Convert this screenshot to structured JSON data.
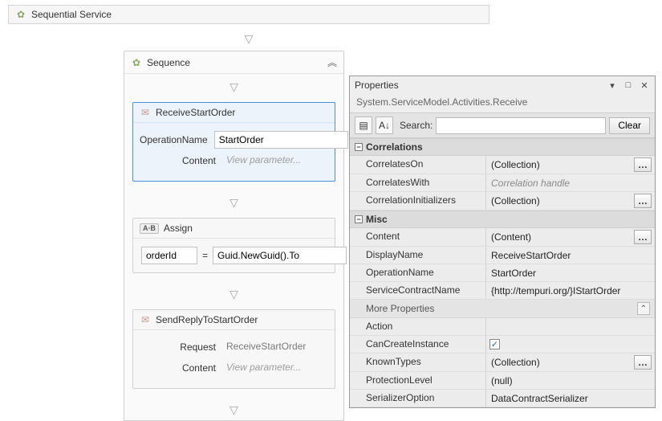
{
  "designer": {
    "root_title": "Sequential Service",
    "sequence": {
      "title": "Sequence",
      "receive": {
        "display_name": "ReceiveStartOrder",
        "op_label": "OperationName",
        "op_value": "StartOrder",
        "content_label": "Content",
        "content_value": "View parameter..."
      },
      "assign": {
        "title": "Assign",
        "left": "orderId",
        "eq": "=",
        "right": "Guid.NewGuid().To"
      },
      "sendreply": {
        "display_name": "SendReplyToStartOrder",
        "req_label": "Request",
        "req_value": "ReceiveStartOrder",
        "content_label": "Content",
        "content_value": "View parameter..."
      }
    }
  },
  "properties": {
    "title": "Properties",
    "subtitle": "System.ServiceModel.Activities.Receive",
    "search_label": "Search:",
    "clear_label": "Clear",
    "groups": {
      "correlations": {
        "label": "Correlations",
        "CorrelatesOn": {
          "label": "CorrelatesOn",
          "value": "(Collection)",
          "ellipsis": true
        },
        "CorrelatesWith": {
          "label": "CorrelatesWith",
          "value": "Correlation handle",
          "italic": true
        },
        "CorrelationInitializers": {
          "label": "CorrelationInitializers",
          "value": "(Collection)",
          "ellipsis": true
        }
      },
      "misc": {
        "label": "Misc",
        "Content": {
          "label": "Content",
          "value": "(Content)",
          "ellipsis": true
        },
        "DisplayName": {
          "label": "DisplayName",
          "value": "ReceiveStartOrder"
        },
        "OperationName": {
          "label": "OperationName",
          "value": "StartOrder"
        },
        "ServiceContractName": {
          "label": "ServiceContractName",
          "value": "{http://tempuri.org/}IStartOrder"
        },
        "more_label": "More Properties",
        "Action": {
          "label": "Action",
          "value": ""
        },
        "CanCreateInstance": {
          "label": "CanCreateInstance",
          "checked": true
        },
        "KnownTypes": {
          "label": "KnownTypes",
          "value": "(Collection)",
          "ellipsis": true
        },
        "ProtectionLevel": {
          "label": "ProtectionLevel",
          "value": "(null)"
        },
        "SerializerOption": {
          "label": "SerializerOption",
          "value": "DataContractSerializer"
        }
      }
    }
  }
}
